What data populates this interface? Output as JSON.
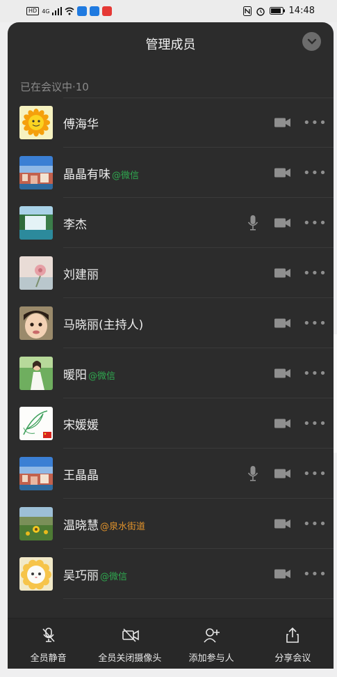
{
  "status_bar": {
    "time": "14:48",
    "hd": "HD",
    "network": "4G"
  },
  "panel": {
    "title": "管理成员",
    "section_label": "已在会议中·10"
  },
  "colors": {
    "wechat_suffix": "#2fa84f",
    "org_suffix": "#e0922b",
    "panel_bg": "#2c2c2c"
  },
  "members": [
    {
      "name": "傅海华",
      "suffix": "",
      "suffix_type": "",
      "mic": false,
      "camera_icon": "camera-off-icon",
      "more": "•••",
      "avatar": "sunflower-cartoon"
    },
    {
      "name": "晶晶有味",
      "suffix": "@微信",
      "suffix_type": "wechat",
      "mic": false,
      "camera_icon": "camera-off-icon",
      "more": "•••",
      "avatar": "harbor-town"
    },
    {
      "name": "李杰",
      "suffix": "",
      "suffix_type": "",
      "mic": true,
      "camera_icon": "camera-off-icon",
      "more": "•••",
      "avatar": "waterfall"
    },
    {
      "name": "刘建丽",
      "suffix": "",
      "suffix_type": "",
      "mic": false,
      "camera_icon": "camera-off-icon",
      "more": "•••",
      "avatar": "pink-flower"
    },
    {
      "name": "马晓丽(主持人)",
      "suffix": "",
      "suffix_type": "",
      "mic": false,
      "camera_icon": "camera-off-icon",
      "more": "•••",
      "avatar": "child-face"
    },
    {
      "name": "暖阳",
      "suffix": "@微信",
      "suffix_type": "wechat",
      "mic": false,
      "camera_icon": "camera-off-icon",
      "more": "•••",
      "avatar": "woman-white-dress"
    },
    {
      "name": "宋媛媛",
      "suffix": "",
      "suffix_type": "",
      "mic": false,
      "camera_icon": "camera-off-icon",
      "more": "•••",
      "avatar": "leaf-sketch"
    },
    {
      "name": "王晶晶",
      "suffix": "",
      "suffix_type": "",
      "mic": true,
      "camera_icon": "camera-off-icon",
      "more": "•••",
      "avatar": "harbor-town"
    },
    {
      "name": "温晓慧",
      "suffix": "@泉水街道",
      "suffix_type": "org",
      "mic": false,
      "camera_icon": "camera-off-icon",
      "more": "•••",
      "avatar": "sunflower-field"
    },
    {
      "name": "吴巧丽",
      "suffix": "@微信",
      "suffix_type": "wechat",
      "mic": false,
      "camera_icon": "camera-off-icon",
      "more": "•••",
      "avatar": "cat-flower"
    }
  ],
  "toolbar": [
    {
      "label": "全员静音",
      "icon": "mic-muted-icon"
    },
    {
      "label": "全员关闭摄像头",
      "icon": "camera-off-icon"
    },
    {
      "label": "添加参与人",
      "icon": "add-person-icon"
    },
    {
      "label": "分享会议",
      "icon": "share-icon"
    }
  ]
}
